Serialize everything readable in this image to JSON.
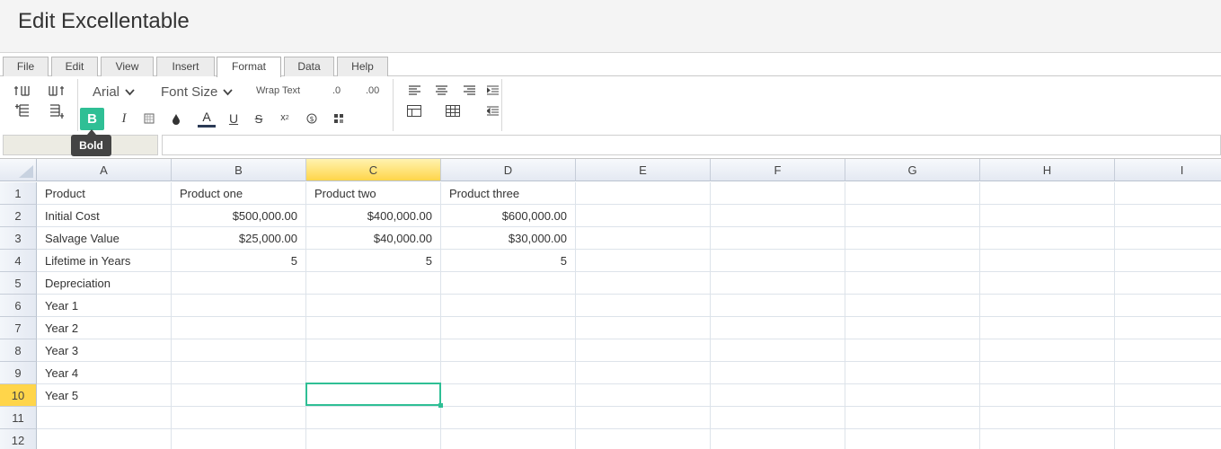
{
  "header": {
    "title": "Edit Excellentable"
  },
  "menu_tabs": [
    {
      "label": "File",
      "active": false
    },
    {
      "label": "Edit",
      "active": false
    },
    {
      "label": "View",
      "active": false
    },
    {
      "label": "Insert",
      "active": false
    },
    {
      "label": "Format",
      "active": true
    },
    {
      "label": "Data",
      "active": false
    },
    {
      "label": "Help",
      "active": false
    }
  ],
  "toolbar": {
    "font_family": "Arial",
    "font_size": "Font Size",
    "wrap_text": "Wrap Text",
    "decrease_decimal": ".0",
    "increase_decimal": ".00",
    "bold": "B",
    "bold_tooltip": "Bold",
    "accent_color": "#2fbf95"
  },
  "name_box": "",
  "formula": "",
  "grid": {
    "columns": [
      "A",
      "B",
      "C",
      "D",
      "E",
      "F",
      "G",
      "H",
      "I"
    ],
    "selected_column": "C",
    "selected_row": 10,
    "rows": [
      {
        "num": "1",
        "cells": [
          "Product",
          "Product one",
          "Product two",
          "Product three",
          "",
          "",
          "",
          "",
          ""
        ]
      },
      {
        "num": "2",
        "cells": [
          "Initial Cost",
          "$500,000.00",
          "$400,000.00",
          "$600,000.00",
          "",
          "",
          "",
          "",
          ""
        ]
      },
      {
        "num": "3",
        "cells": [
          "Salvage Value",
          "$25,000.00",
          "$40,000.00",
          "$30,000.00",
          "",
          "",
          "",
          "",
          ""
        ]
      },
      {
        "num": "4",
        "cells": [
          "Lifetime in Years",
          "5",
          "5",
          "5",
          "",
          "",
          "",
          "",
          ""
        ]
      },
      {
        "num": "5",
        "cells": [
          "Depreciation",
          "",
          "",
          "",
          "",
          "",
          "",
          "",
          ""
        ]
      },
      {
        "num": "6",
        "cells": [
          "Year 1",
          "",
          "",
          "",
          "",
          "",
          "",
          "",
          ""
        ]
      },
      {
        "num": "7",
        "cells": [
          "Year 2",
          "",
          "",
          "",
          "",
          "",
          "",
          "",
          ""
        ]
      },
      {
        "num": "8",
        "cells": [
          "Year 3",
          "",
          "",
          "",
          "",
          "",
          "",
          "",
          ""
        ]
      },
      {
        "num": "9",
        "cells": [
          "Year 4",
          "",
          "",
          "",
          "",
          "",
          "",
          "",
          ""
        ]
      },
      {
        "num": "10",
        "cells": [
          "Year 5",
          "",
          "",
          "",
          "",
          "",
          "",
          "",
          ""
        ]
      },
      {
        "num": "11",
        "cells": [
          "",
          "",
          "",
          "",
          "",
          "",
          "",
          "",
          ""
        ]
      },
      {
        "num": "12",
        "cells": [
          "",
          "",
          "",
          "",
          "",
          "",
          "",
          "",
          ""
        ]
      }
    ]
  }
}
